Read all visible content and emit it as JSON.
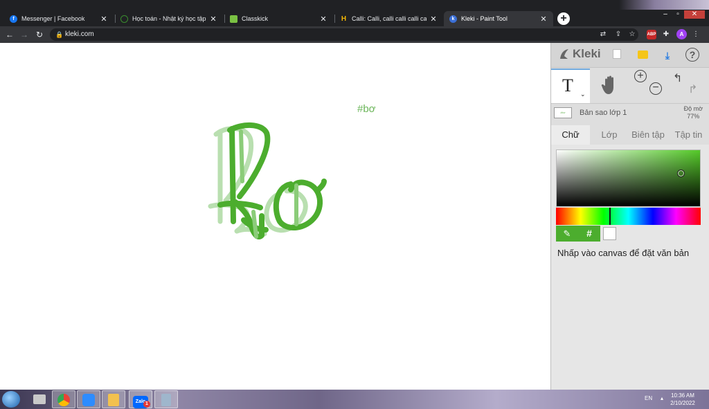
{
  "browser": {
    "tabs": [
      {
        "label": "Messenger | Facebook",
        "favicon": "facebook-icon",
        "color": "#1877f2"
      },
      {
        "label": "Học toán - Nhật ký học tập - Vio",
        "favicon": "violympic-icon",
        "color": "#3a8e2e"
      },
      {
        "label": "Classkick",
        "favicon": "classkick-icon",
        "color": "#7ac143"
      },
      {
        "label": "Calli: Calli, calli calli calli calli calli",
        "favicon": "calli-icon",
        "color": "#f2b705"
      },
      {
        "label": "Kleki - Paint Tool",
        "favicon": "kleki-icon",
        "color": "#3b6fd6",
        "active": true
      }
    ],
    "new_tab": "+",
    "url": "kleki.com"
  },
  "canvas": {
    "text": "#bơ",
    "stroke_color": "#4cad2e",
    "faded_color": "#b9dfb0"
  },
  "sidebar": {
    "logo": "Kleki",
    "layer_name": "Bản sao lớp 1",
    "opacity_label": "Độ mờ",
    "opacity_value": "77%",
    "layer_thumb_text": "#bơ",
    "tabs": [
      "Chữ",
      "Lớp",
      "Biên tập",
      "Tập tin"
    ],
    "active_tab": "Chữ",
    "hash_symbol": "#",
    "hint": "Nhấp vào canvas để đặt văn bản",
    "primary_color": "#54c928",
    "text_tool_label": "T"
  },
  "taskbar": {
    "zalo_label": "Zalo",
    "zalo_badge": "1",
    "lang": "EN",
    "time": "10:36 AM",
    "date": "2/10/2022"
  }
}
